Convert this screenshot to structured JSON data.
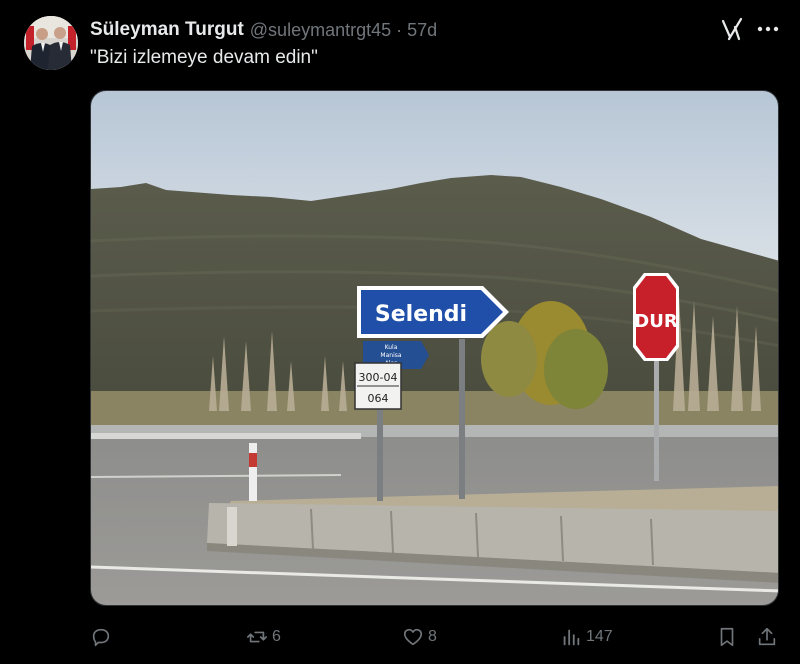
{
  "tweet": {
    "author_name": "Süleyman Turgut",
    "handle": "@suleymantrgt45",
    "separator": "·",
    "time": "57d",
    "text": "\"Bizi izlemeye devam edin\""
  },
  "image": {
    "sign_main": "Selendi",
    "sign_small_line1": "Kula",
    "sign_small_line2": "Manisa",
    "sign_small_line3": "Alaş",
    "road_plate_line1": "300-04",
    "road_plate_line2": "064",
    "stop_sign": "DUR"
  },
  "actions": {
    "reply_icon": "reply-icon",
    "retweet_count": "6",
    "like_count": "8",
    "views_count": "147",
    "bookmark_icon": "bookmark-icon",
    "share_icon": "share-icon"
  },
  "colors": {
    "background": "#000000",
    "text": "#e7e9ea",
    "muted": "#71767b",
    "sign_blue": "#1f4fa8",
    "stop_red": "#c8202a"
  }
}
